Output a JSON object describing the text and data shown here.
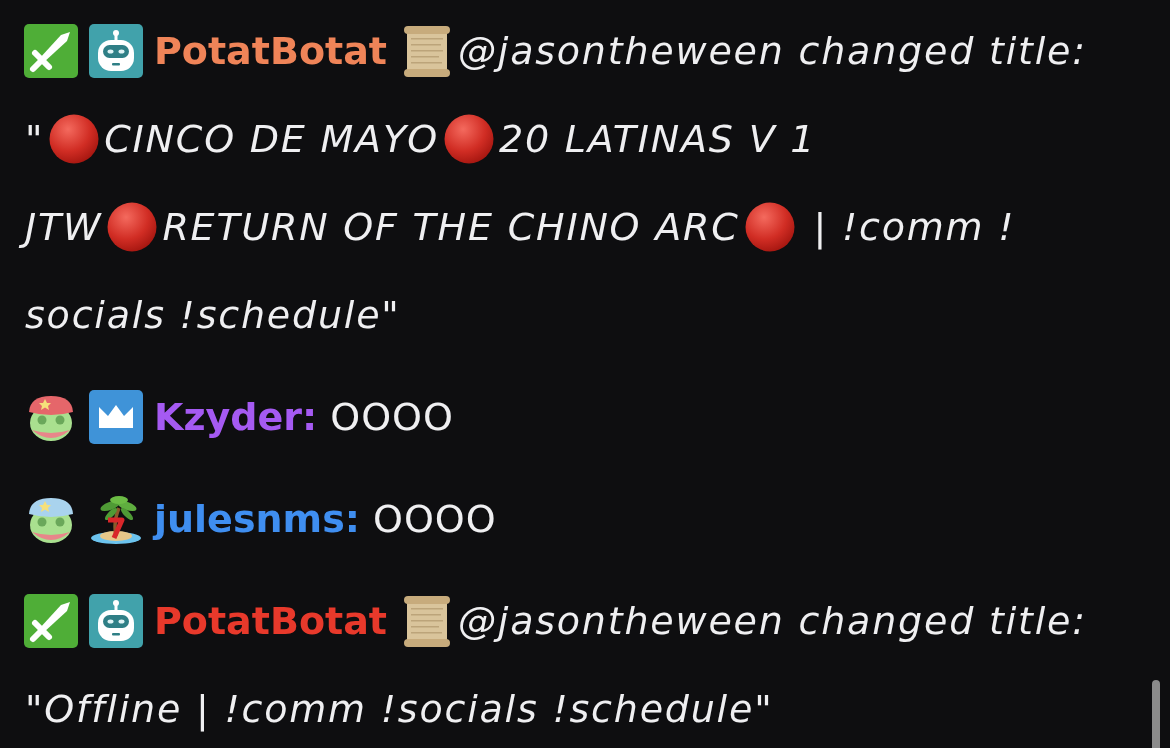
{
  "messages": [
    {
      "kind": "action",
      "badges": [
        {
          "kind": "sword"
        },
        {
          "kind": "robot"
        }
      ],
      "username": "PotatBotat",
      "color": "#ef8458",
      "lines": [
        [
          {
            "kind": "scroll"
          },
          {
            "kind": "text",
            "text": "@jasontheween changed title:"
          }
        ],
        [
          {
            "kind": "text",
            "text": "\""
          },
          {
            "kind": "circle"
          },
          {
            "kind": "text",
            "text": "CINCO DE MAYO"
          },
          {
            "kind": "circle"
          },
          {
            "kind": "text",
            "text": "20 LATINAS V 1"
          }
        ],
        [
          {
            "kind": "text",
            "text": "JTW"
          },
          {
            "kind": "circle"
          },
          {
            "kind": "text",
            "text": "RETURN OF THE CHINO ARC"
          },
          {
            "kind": "circle"
          },
          {
            "kind": "text",
            "text": " | !comm !"
          }
        ],
        [
          {
            "kind": "text",
            "text": "socials !schedule\""
          }
        ]
      ]
    },
    {
      "kind": "chat",
      "badges": [
        {
          "kind": "frog",
          "color": "#e5666a"
        },
        {
          "kind": "crown"
        }
      ],
      "username": "Kzyder:",
      "color": "#a55af2",
      "lines": [
        [
          {
            "kind": "text",
            "text": "OOOO"
          }
        ]
      ]
    },
    {
      "kind": "chat",
      "badges": [
        {
          "kind": "frog",
          "color": "#a9d3ee"
        },
        {
          "kind": "island"
        }
      ],
      "username": "julesnms:",
      "color": "#3f8ef0",
      "lines": [
        [
          {
            "kind": "text",
            "text": "OOOO"
          }
        ]
      ]
    },
    {
      "kind": "action",
      "badges": [
        {
          "kind": "sword"
        },
        {
          "kind": "robot"
        }
      ],
      "username": "PotatBotat",
      "color": "#e8392b",
      "lines": [
        [
          {
            "kind": "scroll"
          },
          {
            "kind": "text",
            "text": "@jasontheween changed title:"
          }
        ],
        [
          {
            "kind": "text",
            "text": "\"Offline | !comm !socials !schedule\""
          }
        ]
      ]
    }
  ]
}
